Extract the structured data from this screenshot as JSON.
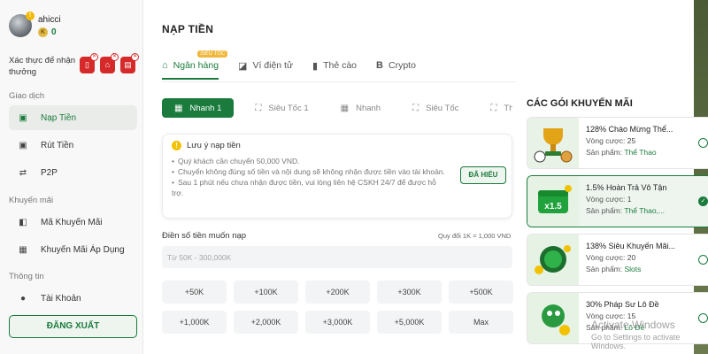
{
  "profile": {
    "username": "ahicci",
    "badge": "!",
    "coins": "0",
    "coin_symbol": "K"
  },
  "verify": {
    "label": "Xác thực để nhận thưởng"
  },
  "sidebar": {
    "section_transactions": "Giao dịch",
    "items": [
      {
        "label": "Nạp Tiền",
        "icon": "deposit-icon"
      },
      {
        "label": "Rút Tiền",
        "icon": "withdraw-icon"
      },
      {
        "label": "P2P",
        "icon": "p2p-icon"
      }
    ],
    "section_promotions": "Khuyến mãi",
    "promo_items": [
      {
        "label": "Mã Khuyến Mãi",
        "icon": "coupon-icon"
      },
      {
        "label": "Khuyến Mãi Áp Dụng",
        "icon": "gift-icon"
      }
    ],
    "section_info": "Thông tin",
    "info_items": [
      {
        "label": "Tài Khoản",
        "icon": "user-icon"
      }
    ],
    "logout": "ĐĂNG XUẤT"
  },
  "main": {
    "title": "NẠP TIỀN",
    "tabs": [
      {
        "label": "Ngân hàng",
        "icon": "bank-icon",
        "badge": "SIÊU TỐC"
      },
      {
        "label": "Ví điện tử",
        "icon": "wallet-icon"
      },
      {
        "label": "Thẻ cào",
        "icon": "card-icon"
      },
      {
        "label": "Crypto",
        "icon": "bitcoin-icon"
      }
    ],
    "methods": [
      {
        "label": "Nhanh 1",
        "icon": "qr-icon"
      },
      {
        "label": "Siêu Tốc 1",
        "icon": "scan-icon"
      },
      {
        "label": "Nhanh",
        "icon": "qr-icon"
      },
      {
        "label": "Siêu Tốc",
        "icon": "scan-icon"
      },
      {
        "label": "Thần T",
        "icon": "scan-icon"
      }
    ],
    "notice": {
      "title": "Lưu ý nạp tiền",
      "lines": [
        "Quý khách cần chuyển 50,000 VND.",
        "Chuyển không đúng số tiền và nội dung sẽ không nhận được tiền vào tài khoản.",
        "Sau 1 phút nếu chưa nhận được tiền, vui lòng liên hệ CSKH 24/7 để được hỗ trợ."
      ],
      "button": "ĐÃ HIỂU"
    },
    "amount": {
      "label": "Điền số tiền muốn nạp",
      "rate": "Quy đổi 1K = 1,000 VND",
      "placeholder": "Từ 50K - 300,000K"
    },
    "quick_amounts": [
      "+50K",
      "+100K",
      "+200K",
      "+300K",
      "+500K",
      "+1,000K",
      "+2,000K",
      "+3,000K",
      "+5,000K",
      "Max"
    ]
  },
  "promotions": {
    "title": "CÁC GÓI KHUYẾN MÃI",
    "round_label": "Vòng cược:",
    "product_label": "Sản phẩm:",
    "items": [
      {
        "name": "128% Chào Mừng Thể...",
        "rounds": "25",
        "product": "Thể Thao",
        "selected": false
      },
      {
        "name": "1.5% Hoàn Trả Vô Tận",
        "rounds": "1",
        "product": "Thể Thao,...",
        "selected": true
      },
      {
        "name": "138% Siêu Khuyến Mãi...",
        "rounds": "20",
        "product": "Slots",
        "selected": false
      },
      {
        "name": "30% Pháp Sư Lô Đề",
        "rounds": "15",
        "product": "Lô Đề",
        "selected": false
      }
    ]
  },
  "watermark": {
    "line1": "Activate Windows",
    "line2": "Go to Settings to activate Windows."
  },
  "colors": {
    "accent": "#1a7b3c",
    "danger": "#d62a2a",
    "warning": "#f2c200"
  }
}
